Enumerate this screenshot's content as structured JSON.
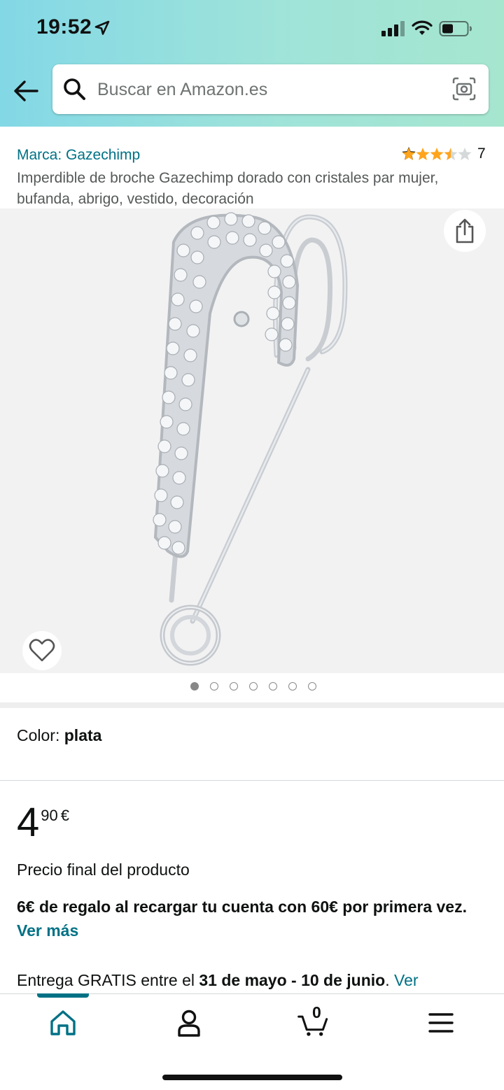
{
  "status_bar": {
    "time": "19:52"
  },
  "search": {
    "placeholder": "Buscar en Amazon.es"
  },
  "product": {
    "brand": "Marca: Gazechimp",
    "rating_stars": 3.5,
    "rating_count": "7",
    "title": "Imperdible de broche Gazechimp dorado con cristales par mujer, bufanda, abrigo, vestido, decoración"
  },
  "gallery": {
    "image_count": 7,
    "active_index": 0
  },
  "color": {
    "label": "Color: ",
    "value": "plata"
  },
  "price": {
    "whole": "4",
    "fraction": "90",
    "currency": "€"
  },
  "final_price": "Precio final del producto",
  "promo": {
    "text": "6€ de regalo al recargar tu cuenta con 60€ por primera vez.",
    "link": "Ver más"
  },
  "delivery": {
    "prefix": "Entrega GRATIS entre el ",
    "dates": "31 de mayo - 10 de junio",
    "suffix": ". ",
    "link": "Ver"
  },
  "tabbar": {
    "cart_count": "0",
    "active": "home"
  },
  "colors": {
    "link": "#007185",
    "star": "#ffa41c",
    "header_start": "#83d8e6",
    "header_end": "#a6e6cf"
  }
}
